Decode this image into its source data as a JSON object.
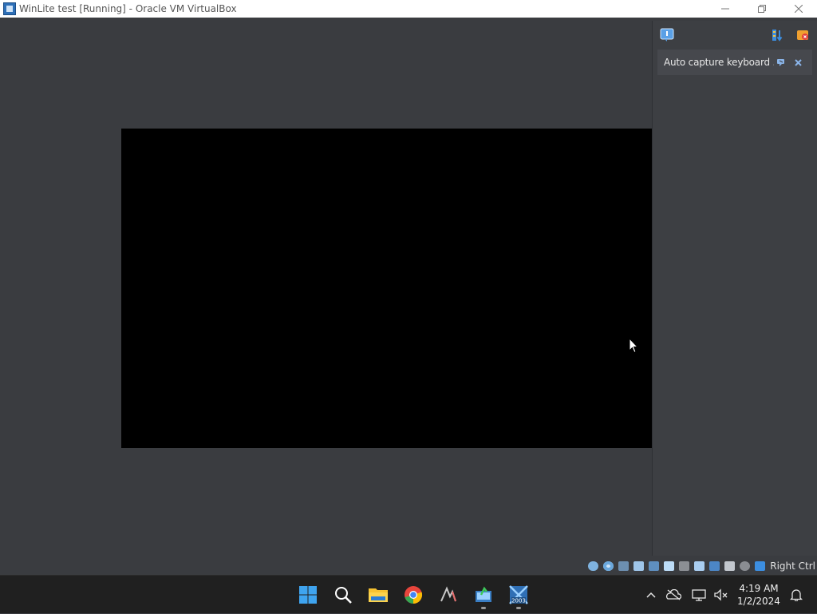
{
  "window": {
    "title": "WinLite test [Running] - Oracle VM VirtualBox",
    "icon": "virtualbox-icon",
    "controls": [
      "minimize-icon",
      "restore-icon",
      "close-icon"
    ]
  },
  "side_panel": {
    "toolbar_icons": [
      "notification-center-icon",
      "sort-icon",
      "delete-notifications-icon"
    ],
    "notification": {
      "text": "Auto capture keyboard ...",
      "actions": [
        "do-not-show-again-icon",
        "close-icon"
      ]
    }
  },
  "statusbar": {
    "icons": [
      "hard-disk-icon",
      "optical-drive-icon",
      "audio-icon",
      "network-icon",
      "usb-icon",
      "shared-folders-icon",
      "display-icon",
      "video-capture-icon",
      "virtualization-icon",
      "mouse-integration-icon",
      "keyboard-icon"
    ],
    "host_key": "Right Ctrl"
  },
  "taskbar": {
    "apps": [
      {
        "icon": "windows-start-icon",
        "running": false
      },
      {
        "icon": "search-icon",
        "running": false
      },
      {
        "icon": "file-explorer-icon",
        "running": false
      },
      {
        "icon": "chrome-icon",
        "running": false
      },
      {
        "icon": "inkscape-icon",
        "running": false
      },
      {
        "icon": "virtualbox-manager-icon",
        "running": true
      },
      {
        "icon": "virtualbox-vm-icon",
        "running": true
      }
    ],
    "vm_icon_label": "2003",
    "tray_icons": [
      "show-hidden-icons-icon",
      "onedrive-icon",
      "network-icon",
      "volume-muted-icon",
      "notifications-icon"
    ],
    "clock": {
      "time": "4:19 AM",
      "date": "1/2/2024"
    }
  }
}
